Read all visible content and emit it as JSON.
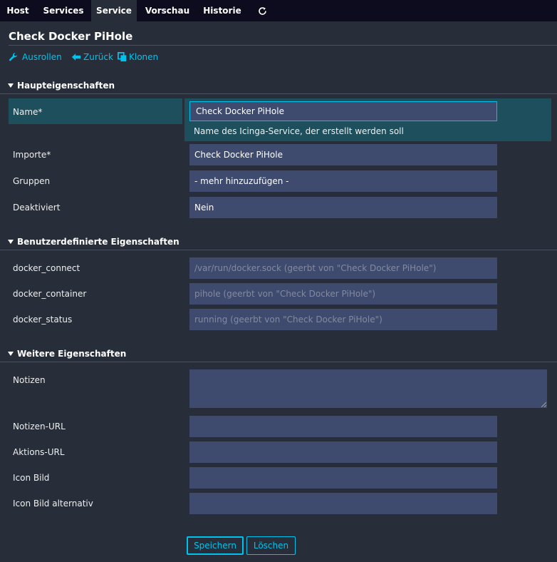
{
  "tabs": [
    {
      "label": "Host",
      "active": false
    },
    {
      "label": "Services",
      "active": false
    },
    {
      "label": "Service",
      "active": true
    },
    {
      "label": "Vorschau",
      "active": false
    },
    {
      "label": "Historie",
      "active": false
    }
  ],
  "refresh_icon": "refresh-icon",
  "title": "Check Docker PiHole",
  "actions": {
    "rollout": {
      "label": "Ausrollen",
      "icon": "wrench-icon"
    },
    "back": {
      "label": "Zurück",
      "icon": "arrow-left-icon"
    },
    "clone": {
      "label": "Klonen",
      "icon": "copy-icon"
    }
  },
  "sections": {
    "main": {
      "title": "Haupteigenschaften",
      "fields": {
        "name": {
          "label": "Name*",
          "value": "Check Docker PiHole",
          "hint": "Name des Icinga-Service, der erstellt werden soll"
        },
        "imports": {
          "label": "Importe*",
          "value": "Check Docker PiHole"
        },
        "groups": {
          "label": "Gruppen",
          "value": "- mehr hinzuzufügen -"
        },
        "disabled": {
          "label": "Deaktiviert",
          "value": "Nein"
        }
      }
    },
    "custom": {
      "title": "Benutzerdefinierte Eigenschaften",
      "fields": {
        "docker_connect": {
          "label": "docker_connect",
          "placeholder": "/var/run/docker.sock (geerbt von \"Check Docker PiHole\")"
        },
        "docker_container": {
          "label": "docker_container",
          "placeholder": "pihole (geerbt von \"Check Docker PiHole\")"
        },
        "docker_status": {
          "label": "docker_status",
          "placeholder": "running (geerbt von \"Check Docker PiHole\")"
        }
      }
    },
    "more": {
      "title": "Weitere Eigenschaften",
      "fields": {
        "notes": {
          "label": "Notizen",
          "value": ""
        },
        "notes_url": {
          "label": "Notizen-URL",
          "value": ""
        },
        "action_url": {
          "label": "Aktions-URL",
          "value": ""
        },
        "icon_image": {
          "label": "Icon Bild",
          "value": ""
        },
        "icon_image_alt": {
          "label": "Icon Bild alternativ",
          "value": ""
        }
      }
    }
  },
  "buttons": {
    "save": "Speichern",
    "delete": "Löschen"
  },
  "colors": {
    "background": "#282e39",
    "tabbar": "#0c0c1e",
    "accent": "#00c3ed",
    "input": "#3e4a6e",
    "focus_row": "#1e4f5d"
  }
}
